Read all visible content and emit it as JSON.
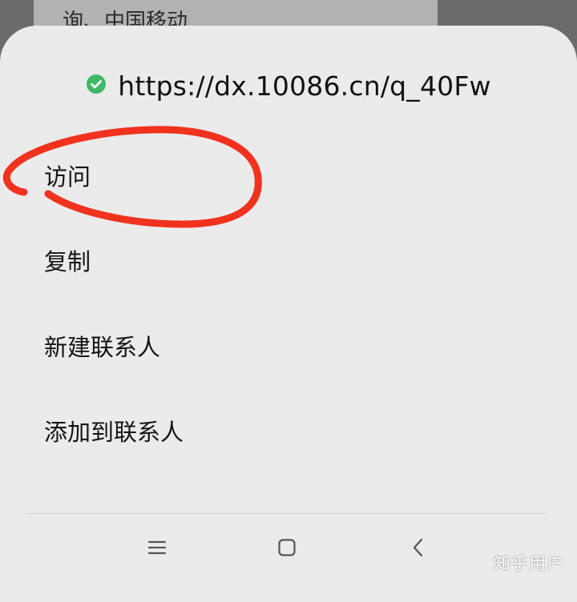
{
  "background": {
    "notification_text": "询、中国移动"
  },
  "sheet": {
    "url": "https://dx.10086.cn/q_40Fw",
    "secure_icon": "check-circle-icon",
    "secure_color": "#3fb868",
    "menu_items": [
      {
        "label": "访问"
      },
      {
        "label": "复制"
      },
      {
        "label": "新建联系人"
      },
      {
        "label": "添加到联系人"
      }
    ]
  },
  "annotation": {
    "color": "#f0321e",
    "encircles": "访问"
  },
  "navbar": {
    "icons": [
      "menu-icon",
      "home-icon",
      "back-icon"
    ]
  },
  "watermark": "知乎用户"
}
